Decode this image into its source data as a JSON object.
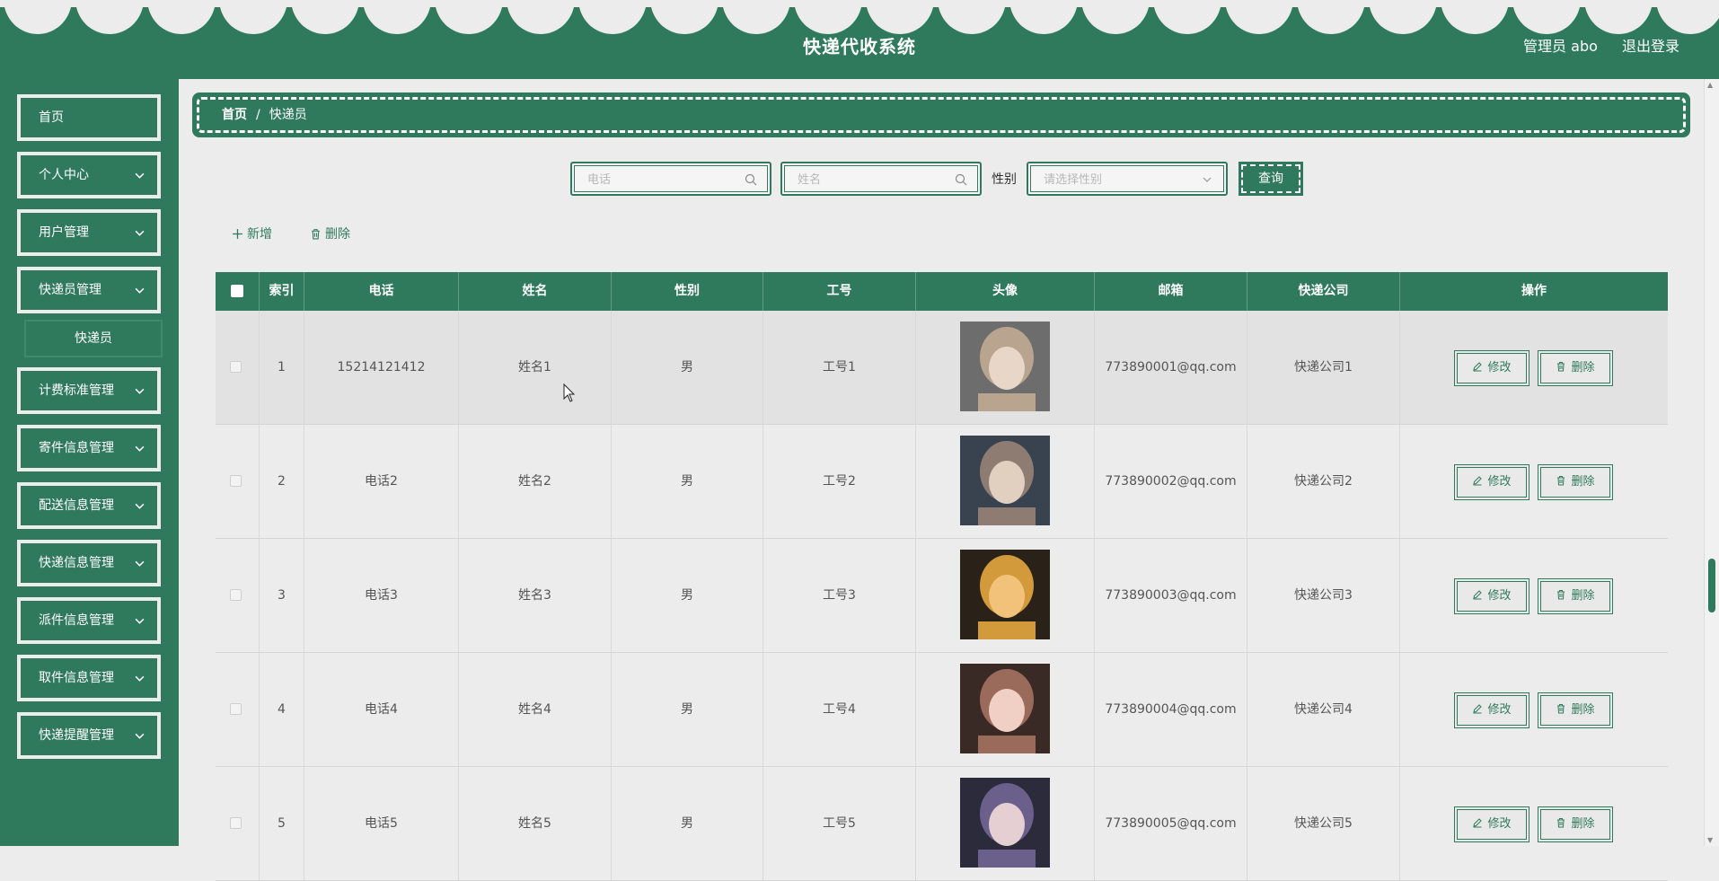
{
  "header": {
    "title": "快递代收系统",
    "user_label": "管理员 abo",
    "logout_label": "退出登录"
  },
  "sidebar": {
    "items": [
      {
        "label": "首页",
        "has_children": false
      },
      {
        "label": "个人中心",
        "has_children": true
      },
      {
        "label": "用户管理",
        "has_children": true
      },
      {
        "label": "快递员管理",
        "has_children": true
      },
      {
        "label": "计费标准管理",
        "has_children": true
      },
      {
        "label": "寄件信息管理",
        "has_children": true
      },
      {
        "label": "配送信息管理",
        "has_children": true
      },
      {
        "label": "快递信息管理",
        "has_children": true
      },
      {
        "label": "派件信息管理",
        "has_children": true
      },
      {
        "label": "取件信息管理",
        "has_children": true
      },
      {
        "label": "快递提醒管理",
        "has_children": true
      }
    ],
    "submenu": {
      "label": "快递员"
    }
  },
  "breadcrumb": {
    "home": "首页",
    "separator": "/",
    "current": "快递员"
  },
  "search": {
    "phone_placeholder": "电话",
    "name_placeholder": "姓名",
    "gender_label": "性别",
    "gender_placeholder": "请选择性别",
    "query_label": "查询"
  },
  "actions": {
    "add_label": "新增",
    "delete_label": "删除"
  },
  "table": {
    "columns": [
      "索引",
      "电话",
      "姓名",
      "性别",
      "工号",
      "头像",
      "邮箱",
      "快递公司",
      "操作"
    ],
    "edit_label": "修改",
    "delete_label": "删除",
    "rows": [
      {
        "index": "1",
        "phone": "15214121412",
        "name": "姓名1",
        "gender": "男",
        "job_no": "工号1",
        "email": "773890001@qq.com",
        "company": "快递公司1"
      },
      {
        "index": "2",
        "phone": "电话2",
        "name": "姓名2",
        "gender": "男",
        "job_no": "工号2",
        "email": "773890002@qq.com",
        "company": "快递公司2"
      },
      {
        "index": "3",
        "phone": "电话3",
        "name": "姓名3",
        "gender": "男",
        "job_no": "工号3",
        "email": "773890003@qq.com",
        "company": "快递公司3"
      },
      {
        "index": "4",
        "phone": "电话4",
        "name": "姓名4",
        "gender": "男",
        "job_no": "工号4",
        "email": "773890004@qq.com",
        "company": "快递公司4"
      },
      {
        "index": "5",
        "phone": "电话5",
        "name": "姓名5",
        "gender": "男",
        "job_no": "工号5",
        "email": "773890005@qq.com",
        "company": "快递公司5"
      }
    ]
  },
  "colors": {
    "primary": "#2f7a5c",
    "background": "#ececec"
  }
}
